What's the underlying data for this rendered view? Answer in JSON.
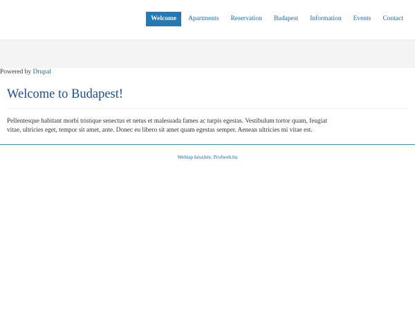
{
  "nav": {
    "items": [
      {
        "label": "Welcome",
        "active": true
      },
      {
        "label": "Apartments",
        "active": false
      },
      {
        "label": "Reservation",
        "active": false
      },
      {
        "label": "Budapest",
        "active": false
      },
      {
        "label": "Information",
        "active": false
      },
      {
        "label": "Events",
        "active": false
      },
      {
        "label": "Contact",
        "active": false
      }
    ]
  },
  "powered_by": {
    "prefix": "Powered by",
    "link": "Drupal"
  },
  "main": {
    "title": "Welcome to Budapest!",
    "body": "Pellentesque habitant morbi tristique senectus et netus et malesuada fames ac turpis egestas. Vestibulum tortor quam, feugiat vitae, ultricies eget, tempor sit amet, ante. Donec eu libero sit amet quam egestas semper. Aenean ultricies mi vitae est."
  },
  "footer": {
    "credit": "Weblap készítés: Profweb.hu"
  },
  "colors": {
    "accent": "#1f7ab7",
    "link": "#1f67a8",
    "title": "#1f4f8a",
    "band": "#f4f4f4"
  }
}
